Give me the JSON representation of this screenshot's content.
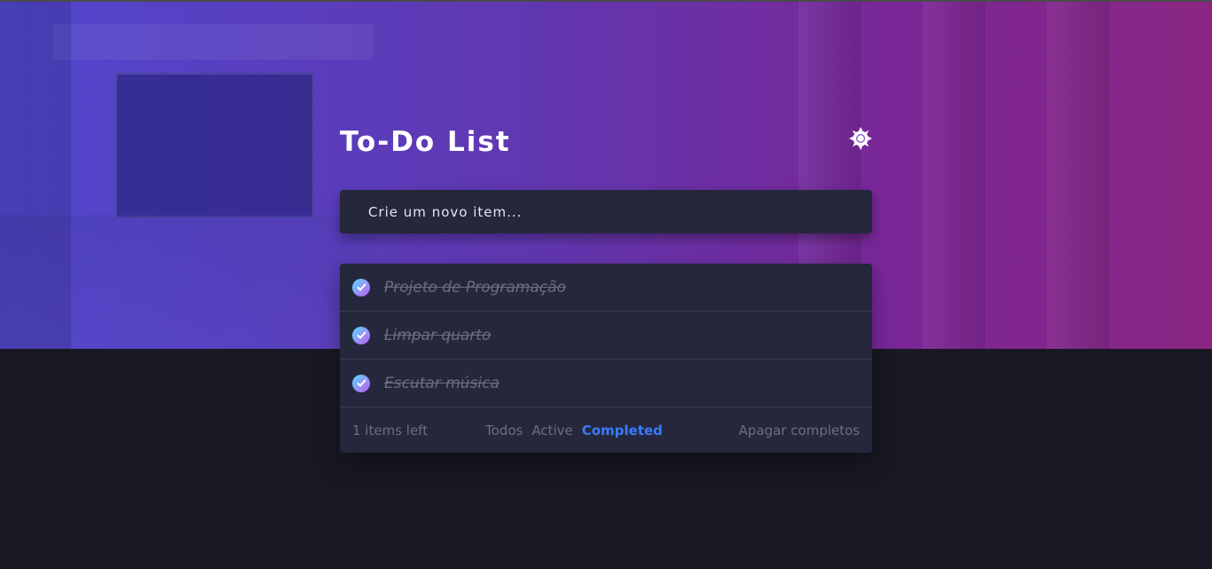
{
  "app": {
    "title": "To-Do List"
  },
  "input": {
    "placeholder": "Crie um novo item..."
  },
  "todos": [
    {
      "text": "Projeto de Programação",
      "completed": true
    },
    {
      "text": "Limpar quarto",
      "completed": true
    },
    {
      "text": "Escutar música",
      "completed": true
    }
  ],
  "footer": {
    "items_left": "1 items left",
    "filters": [
      "Todos",
      "Active",
      "Completed"
    ],
    "active_filter": "Completed",
    "clear_label": "Apagar completos"
  },
  "colors": {
    "accent": "#3a7bfd",
    "card": "#25273c",
    "background": "#181824",
    "check_gradient_start": "#57ddff",
    "check_gradient_end": "#c058f3"
  },
  "icons": {
    "theme_toggle": "sun-icon",
    "check": "check-icon"
  }
}
